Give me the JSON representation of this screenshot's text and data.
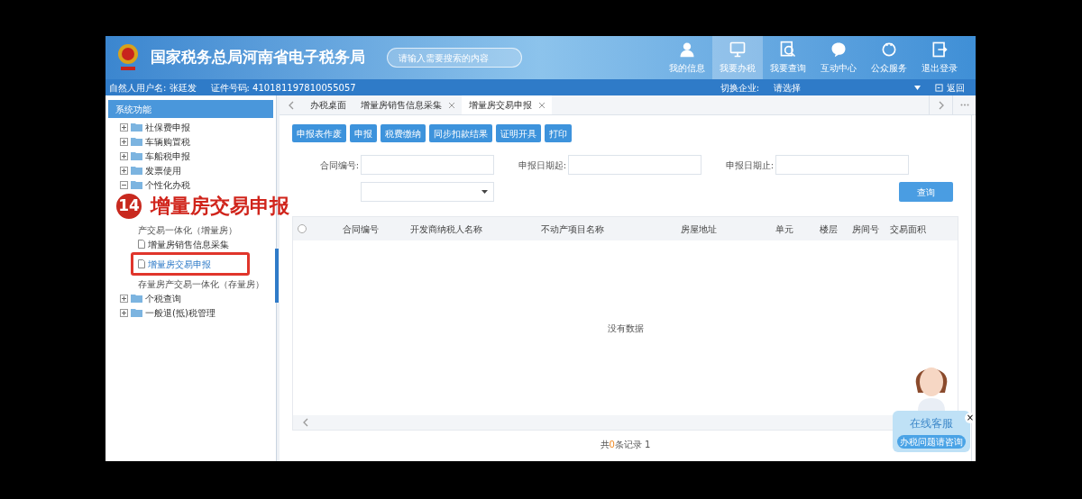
{
  "header": {
    "title": "国家税务总局河南省电子税务局",
    "search": {
      "placeholder": "请输入需要搜索的内容"
    },
    "nav": [
      {
        "label": "我的信息",
        "selected": false
      },
      {
        "label": "我要办税",
        "selected": true
      },
      {
        "label": "我要查询",
        "selected": false
      },
      {
        "label": "互动中心",
        "selected": false
      },
      {
        "label": "公众服务",
        "selected": false
      },
      {
        "label": "退出登录",
        "selected": false
      }
    ]
  },
  "user_bar": {
    "user": "自然人用户名: 张廷发",
    "id": "证件号码: 410181197810055057",
    "switch_label": "切换企业:",
    "switch_value": "请选择",
    "back": "返回"
  },
  "sidebar": {
    "title": "系统功能",
    "items": [
      {
        "label": "社保费申报",
        "kind": "folder",
        "expanded": false
      },
      {
        "label": "车辆购置税",
        "kind": "folder",
        "expanded": false
      },
      {
        "label": "车船税申报",
        "kind": "folder",
        "expanded": false
      },
      {
        "label": "发票使用",
        "kind": "folder",
        "expanded": false
      },
      {
        "label": "个性化办税",
        "kind": "folder",
        "expanded": true,
        "children": [
          {
            "kind": "blank"
          },
          {
            "label": "产交易一体化（增量房）",
            "kind": "text"
          },
          {
            "label": "增量房销售信息采集",
            "kind": "file",
            "selected": false
          },
          {
            "label": "增量房交易申报",
            "kind": "file",
            "selected": true
          },
          {
            "label": "存量房产交易一体化（存量房）",
            "kind": "text"
          }
        ]
      },
      {
        "label": "个税查询",
        "kind": "folder",
        "expanded": false
      },
      {
        "label": "一般退(抵)税管理",
        "kind": "folder",
        "expanded": false
      }
    ]
  },
  "tabs": [
    {
      "label": "办税桌面",
      "closable": false,
      "selected": false
    },
    {
      "label": "增量房销售信息采集",
      "closable": true,
      "selected": false
    },
    {
      "label": "增量房交易申报",
      "closable": true,
      "selected": true
    }
  ],
  "toolbar": [
    "申报表作废",
    "申报",
    "税费缴纳",
    "同步扣款结果",
    "证明开具",
    "打印"
  ],
  "filters": [
    {
      "label": "合同编号:"
    },
    {
      "label": "申报日期起:"
    },
    {
      "label": "申报日期止:"
    }
  ],
  "query_button": "查询",
  "table": {
    "select_all": {
      "checked": false
    },
    "columns": [
      "合同编号",
      "开发商纳税人名称",
      "不动产项目名称",
      "房屋地址",
      "单元",
      "楼层",
      "房间号",
      "交易面积"
    ],
    "empty": "没有数据"
  },
  "footer": "共**0**条记录 1",
  "annotation": {
    "number": "14",
    "text": "增量房交易申报"
  },
  "chat_widget": {
    "title": "在线客服",
    "subtitle": "办税问题请咨询",
    "close": "×"
  }
}
